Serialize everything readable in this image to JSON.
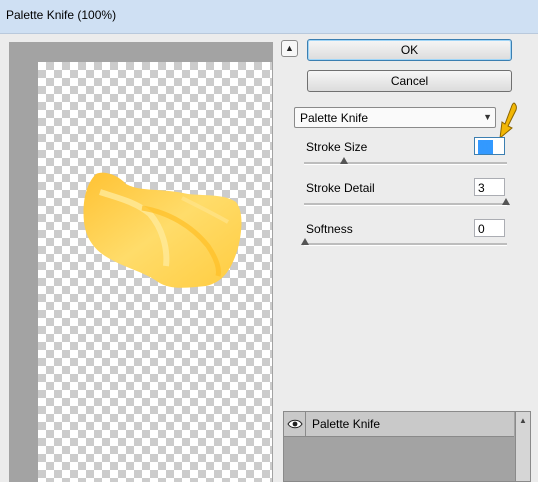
{
  "window": {
    "title": "Palette Knife (100%)"
  },
  "buttons": {
    "ok": "OK",
    "cancel": "Cancel"
  },
  "filter": {
    "selected": "Palette Knife"
  },
  "params": [
    {
      "label": "Stroke Size",
      "value": "10",
      "slider": 0.2
    },
    {
      "label": "Stroke Detail",
      "value": "3",
      "slider": 1.0
    },
    {
      "label": "Softness",
      "value": "0",
      "slider": 0.0
    }
  ],
  "layers": {
    "items": [
      {
        "label": "Palette Knife"
      }
    ]
  },
  "icons": {
    "collapse": "double-chevron-up-icon",
    "dropdown": "dropdown-arrow-icon",
    "eye": "eye-icon",
    "annotation": "yellow-arrow-icon"
  },
  "colors": {
    "title_bar": "#cfe0f3",
    "accent": "#3399ff",
    "paint": "#ffc83a"
  }
}
